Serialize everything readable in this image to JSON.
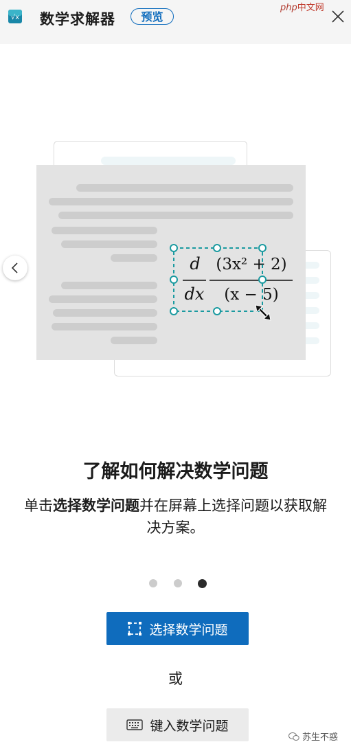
{
  "header": {
    "app_title": "数学求解器",
    "badge": "预览",
    "app_icon": "math-solver-app-icon",
    "close_icon": "close-icon"
  },
  "watermark_top": {
    "brand": "php",
    "site": "中文网"
  },
  "illustration": {
    "formula": {
      "numerator_left": "d",
      "denominator_left": "dx",
      "numerator_right": "(3x² + 2)",
      "denominator_right": "(x − 5)"
    }
  },
  "main": {
    "heading": "了解如何解决数学问题",
    "desc_prefix": "单击",
    "desc_bold": "选择数学问题",
    "desc_suffix": "并在屏幕上选择问题以获取解决方案。"
  },
  "carousel": {
    "count": 3,
    "active_index": 2
  },
  "actions": {
    "select_label": "选择数学问题",
    "or_label": "或",
    "type_label": "键入数学问题"
  },
  "watermark_bottom": {
    "text": "苏生不惑"
  },
  "colors": {
    "accent": "#0f6cbd",
    "selection": "#1a9aa0"
  }
}
